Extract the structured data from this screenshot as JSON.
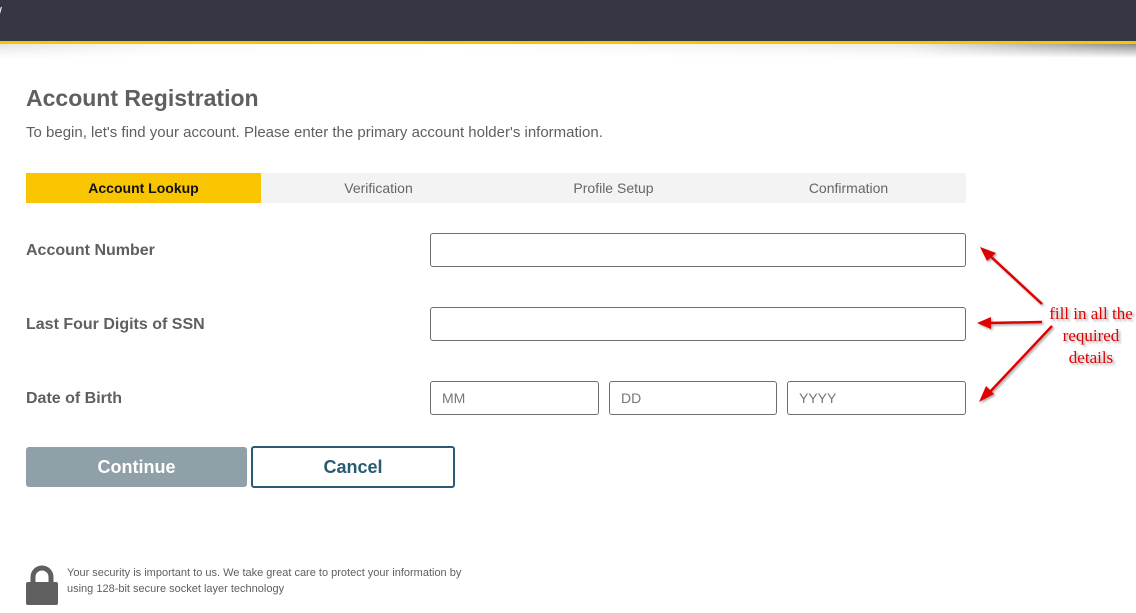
{
  "header": {
    "glyph": "/",
    "accent_color": "#f9c400",
    "bar_color": "#353744"
  },
  "page": {
    "title": "Account Registration",
    "subtitle": "To begin, let's find your account. Please enter the primary account holder's information."
  },
  "steps": [
    {
      "label": "Account Lookup",
      "active": true
    },
    {
      "label": "Verification",
      "active": false
    },
    {
      "label": "Profile Setup",
      "active": false
    },
    {
      "label": "Confirmation",
      "active": false
    }
  ],
  "form": {
    "account_number": {
      "label": "Account Number",
      "value": "",
      "placeholder": ""
    },
    "ssn_last_four": {
      "label": "Last Four Digits of SSN",
      "value": "",
      "placeholder": ""
    },
    "date_of_birth": {
      "label": "Date of Birth",
      "month_placeholder": "MM",
      "day_placeholder": "DD",
      "year_placeholder": "YYYY"
    }
  },
  "buttons": {
    "continue_label": "Continue",
    "cancel_label": "Cancel"
  },
  "annotation": {
    "line1": "fill in all the",
    "line2": "required",
    "line3": "details",
    "color": "#e00000"
  },
  "security": {
    "icon": "lock-icon",
    "text": "Your security is important to us. We take great care to protect your information by using 128-bit secure socket layer technology"
  }
}
